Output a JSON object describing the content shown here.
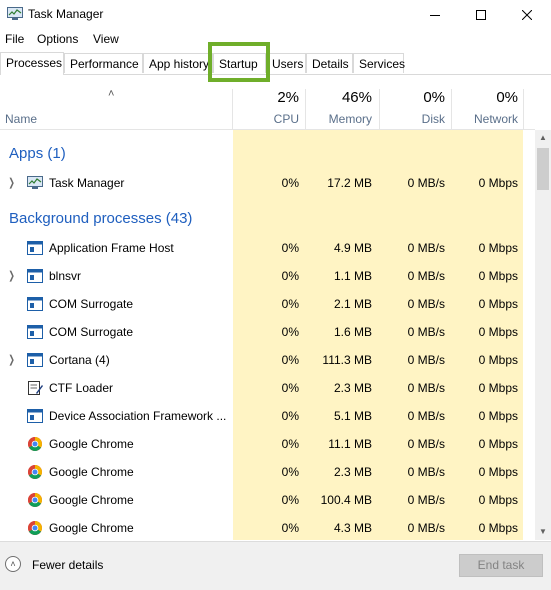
{
  "window": {
    "title": "Task Manager"
  },
  "menu": [
    "File",
    "Options",
    "View"
  ],
  "tabs": [
    "Processes",
    "Performance",
    "App history",
    "Startup",
    "Users",
    "Details",
    "Services"
  ],
  "header": {
    "name_label": "Name",
    "columns": [
      {
        "pct": "2%",
        "label": "CPU"
      },
      {
        "pct": "46%",
        "label": "Memory"
      },
      {
        "pct": "0%",
        "label": "Disk"
      },
      {
        "pct": "0%",
        "label": "Network"
      }
    ]
  },
  "groups": {
    "apps": "Apps (1)",
    "background": "Background processes (43)"
  },
  "apps": [
    {
      "name": "Task Manager",
      "cpu": "0%",
      "memory": "17.2 MB",
      "disk": "0 MB/s",
      "network": "0 Mbps",
      "icon": "task-manager-icon",
      "expandable": true
    }
  ],
  "background": [
    {
      "name": "Application Frame Host",
      "cpu": "0%",
      "memory": "4.9 MB",
      "disk": "0 MB/s",
      "network": "0 Mbps",
      "icon": "window-icon",
      "expandable": false
    },
    {
      "name": "blnsvr",
      "cpu": "0%",
      "memory": "1.1 MB",
      "disk": "0 MB/s",
      "network": "0 Mbps",
      "icon": "window-icon",
      "expandable": true
    },
    {
      "name": "COM Surrogate",
      "cpu": "0%",
      "memory": "2.1 MB",
      "disk": "0 MB/s",
      "network": "0 Mbps",
      "icon": "window-icon",
      "expandable": false
    },
    {
      "name": "COM Surrogate",
      "cpu": "0%",
      "memory": "1.6 MB",
      "disk": "0 MB/s",
      "network": "0 Mbps",
      "icon": "window-icon",
      "expandable": false
    },
    {
      "name": "Cortana (4)",
      "cpu": "0%",
      "memory": "111.3 MB",
      "disk": "0 MB/s",
      "network": "0 Mbps",
      "icon": "window-icon",
      "expandable": true
    },
    {
      "name": "CTF Loader",
      "cpu": "0%",
      "memory": "2.3 MB",
      "disk": "0 MB/s",
      "network": "0 Mbps",
      "icon": "pen-icon",
      "expandable": false
    },
    {
      "name": "Device Association Framework ...",
      "cpu": "0%",
      "memory": "5.1 MB",
      "disk": "0 MB/s",
      "network": "0 Mbps",
      "icon": "window-icon",
      "expandable": false
    },
    {
      "name": "Google Chrome",
      "cpu": "0%",
      "memory": "11.1 MB",
      "disk": "0 MB/s",
      "network": "0 Mbps",
      "icon": "chrome-icon",
      "expandable": false
    },
    {
      "name": "Google Chrome",
      "cpu": "0%",
      "memory": "2.3 MB",
      "disk": "0 MB/s",
      "network": "0 Mbps",
      "icon": "chrome-icon",
      "expandable": false
    },
    {
      "name": "Google Chrome",
      "cpu": "0%",
      "memory": "100.4 MB",
      "disk": "0 MB/s",
      "network": "0 Mbps",
      "icon": "chrome-icon",
      "expandable": false
    },
    {
      "name": "Google Chrome",
      "cpu": "0%",
      "memory": "4.3 MB",
      "disk": "0 MB/s",
      "network": "0 Mbps",
      "icon": "chrome-icon",
      "expandable": false
    }
  ],
  "footer": {
    "fewer_details": "Fewer details",
    "end_task": "End task"
  },
  "colors": {
    "group_heading": "#1f5fbf",
    "heat": "#fff4c4",
    "highlight": "#6fae2a"
  }
}
